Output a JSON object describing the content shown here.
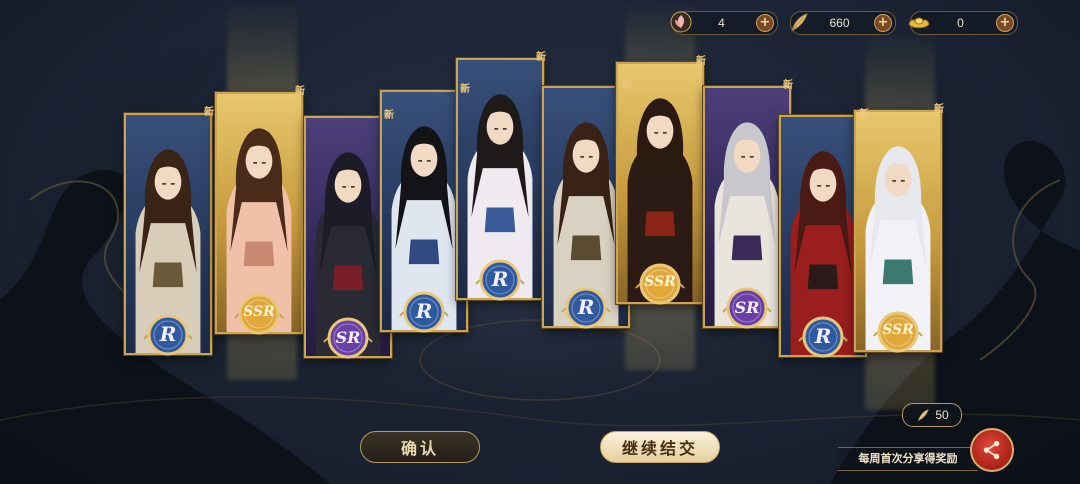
{
  "currency": [
    {
      "icon": "peach-blossom-icon",
      "value": "4"
    },
    {
      "icon": "feather-icon",
      "value": "660"
    },
    {
      "icon": "gold-ingot-icon",
      "value": "0"
    }
  ],
  "new_tag": "新",
  "cards": [
    {
      "rarity": "R",
      "rarity_label": "R",
      "hair": "#3a2418",
      "robe": "#d8cdb8",
      "sash": "#6b5a3a"
    },
    {
      "rarity": "SSR",
      "rarity_label": "SSR",
      "hair": "#4a2a18",
      "robe": "#f0c0a8",
      "sash": "#c98872"
    },
    {
      "rarity": "SR",
      "rarity_label": "SR",
      "hair": "#1c1c28",
      "robe": "#2a2a34",
      "sash": "#7a1f2a"
    },
    {
      "rarity": "R",
      "rarity_label": "R",
      "hair": "#141418",
      "robe": "#dfe6f0",
      "sash": "#2f4a80"
    },
    {
      "rarity": "R",
      "rarity_label": "R",
      "hair": "#1e1a1a",
      "robe": "#eeeaf0",
      "sash": "#3a5a9a"
    },
    {
      "rarity": "R",
      "rarity_label": "R",
      "hair": "#3a2216",
      "robe": "#d9d2c2",
      "sash": "#5b4b30"
    },
    {
      "rarity": "SSR",
      "rarity_label": "SSR",
      "hair": "#2a1a12",
      "robe": "#2c1a14",
      "sash": "#8a2418"
    },
    {
      "rarity": "SR",
      "rarity_label": "SR",
      "hair": "#c8c8cc",
      "robe": "#e9e4dc",
      "sash": "#3a2a5a"
    },
    {
      "rarity": "R",
      "rarity_label": "R",
      "hair": "#4a1a14",
      "robe": "#9a1e1e",
      "sash": "#2a1a1a"
    },
    {
      "rarity": "SSR",
      "rarity_label": "SSR",
      "hair": "#e6e8ee",
      "robe": "#f2f2f6",
      "sash": "#3a7a70"
    }
  ],
  "buttons": {
    "confirm": "确认",
    "continue": "继续结交"
  },
  "share": {
    "reward_count": "50",
    "reward_icon": "feather-icon",
    "banner_text": "每周首次分享得奖励",
    "button_icon": "share-icon"
  },
  "colors": {
    "gold_frame": "#c9a456",
    "r_badge": "#2f5aa0",
    "sr_badge": "#6a3fa8",
    "ssr_badge": "#e0a83a"
  }
}
